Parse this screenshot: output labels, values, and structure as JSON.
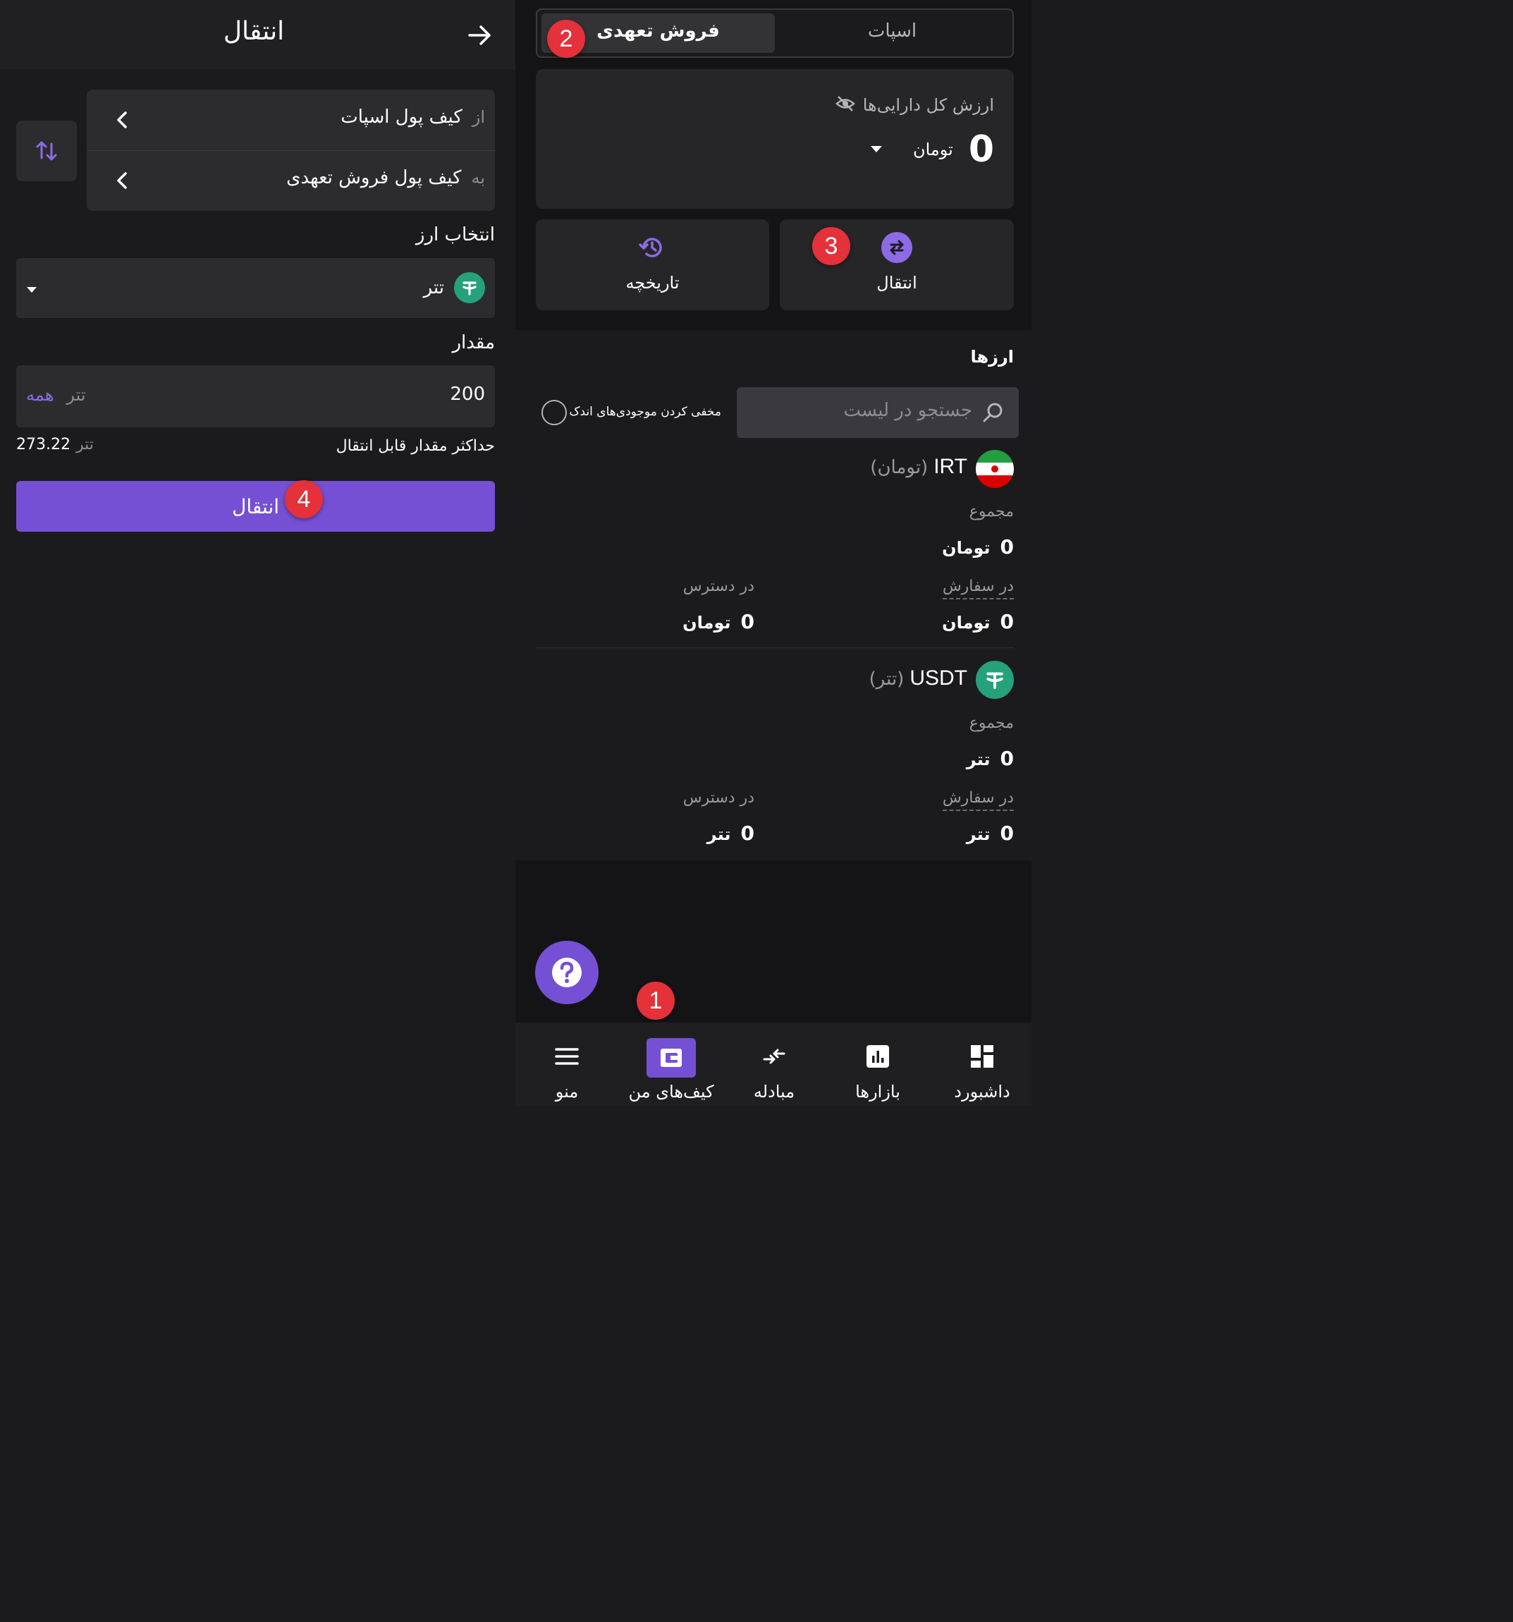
{
  "transfer_page": {
    "title": "انتقال",
    "from_prefix": "از",
    "from_value": "کیف پول اسپات",
    "to_prefix": "به",
    "to_value": "کیف پول فروش تعهدی",
    "currency_label": "انتخاب ارز",
    "currency_selected": "تتر",
    "amount_label": "مقدار",
    "amount_value": "200",
    "amount_unit": "تتر",
    "amount_all": "همه",
    "max_label": "حداکثر مقدار قابل انتقال",
    "max_value": "273.22",
    "max_unit": "تتر",
    "submit_label": "انتقال"
  },
  "wallet_page": {
    "tabs": [
      "اسپات",
      "فروش تعهدی"
    ],
    "active_tab": "فروش تعهدی",
    "total_label": "ارزش کل دارایی‌ها",
    "total_value": "0",
    "total_unit": "تومان",
    "actions": [
      {
        "label": "انتقال",
        "icon": "swap-icon"
      },
      {
        "label": "تاریخچه",
        "icon": "history-icon"
      }
    ],
    "assets_title": "ارزها",
    "search_placeholder": "جستجو در لیست",
    "hide_small_label": "مخفی کردن موجودی‌های اندک",
    "assets": [
      {
        "code": "IRT",
        "name": "(تومان)",
        "total_label": "مجموع",
        "total": "0",
        "unit": "تومان",
        "in_order_label": "در سفارش",
        "in_order": "0",
        "available_label": "در دسترس",
        "available": "0"
      },
      {
        "code": "USDT",
        "name": "(تتر)",
        "total_label": "مجموع",
        "total": "0",
        "unit": "تتر",
        "in_order_label": "در سفارش",
        "in_order": "0",
        "available_label": "در دسترس",
        "available": "0"
      }
    ]
  },
  "bottom_nav": {
    "items": [
      "داشبورد",
      "بازارها",
      "مبادله",
      "کیف‌های من",
      "منو"
    ],
    "active": "کیف‌های من"
  },
  "badges": [
    "1",
    "2",
    "3",
    "4"
  ],
  "colors": {
    "accent": "#7650d4",
    "tether_green": "#26a17b",
    "badge_red": "#e5313a",
    "background": "#1b1b1d"
  }
}
